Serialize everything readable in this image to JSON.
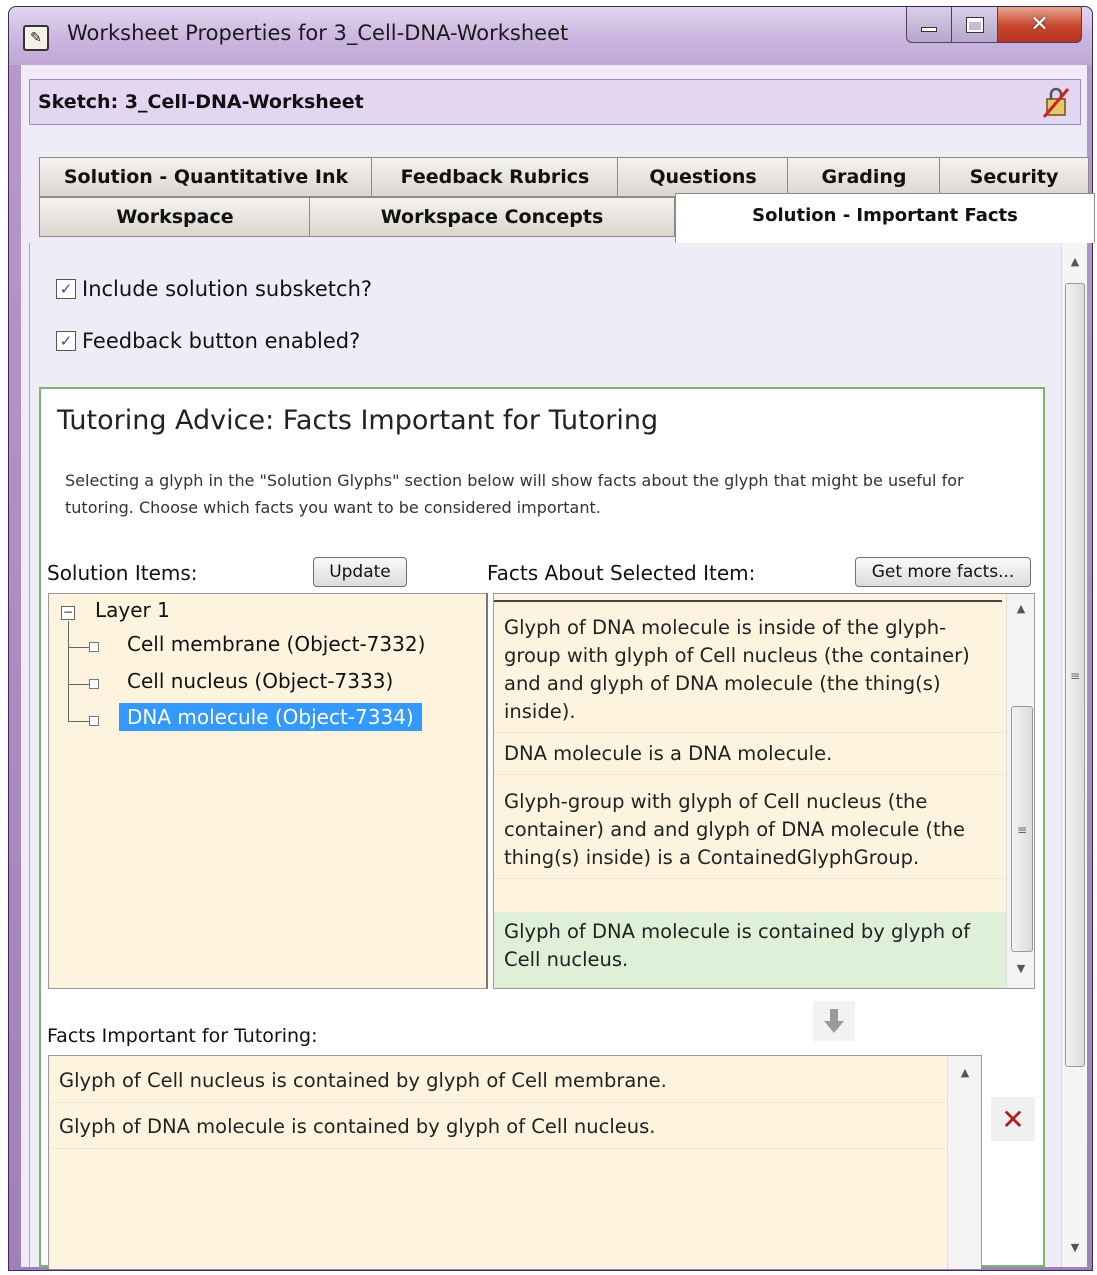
{
  "window": {
    "title": "Worksheet Properties for 3_Cell-DNA-Worksheet",
    "icon": "app-icon"
  },
  "sketch": {
    "label": "Sketch: 3_Cell-DNA-Worksheet",
    "lock_icon": "lock-icon"
  },
  "tabs": {
    "row1": [
      "Solution - Quantitative Ink",
      "Feedback Rubrics",
      "Questions",
      "Grading",
      "Security"
    ],
    "row2": [
      "Workspace",
      "Workspace Concepts",
      "Solution - Important Facts"
    ],
    "active": "Solution - Important Facts"
  },
  "options": {
    "include_solution": {
      "label": "Include solution subsketch?",
      "checked": true
    },
    "feedback_enabled": {
      "label": "Feedback button enabled?",
      "checked": true
    }
  },
  "advice": {
    "title": "Tutoring Advice:  Facts Important for Tutoring",
    "description": "Selecting a glyph in the \"Solution Glyphs\" section below will show facts about the glyph that might be useful for tutoring.  Choose which facts you want to be considered important."
  },
  "solution_items": {
    "label": "Solution Items:",
    "update_button": "Update",
    "tree": {
      "root": "Layer 1",
      "children": [
        "Cell membrane (Object-7332)",
        "Cell nucleus (Object-7333)",
        "DNA molecule (Object-7334)"
      ],
      "selected": "DNA molecule (Object-7334)"
    }
  },
  "facts_selected": {
    "label": "Facts About Selected Item:",
    "more_button": "Get more facts...",
    "items": [
      "Glyph of DNA molecule is inside of the glyph-group with glyph of Cell nucleus (the container) and and glyph of DNA molecule (the thing(s) inside).",
      "DNA molecule is a DNA molecule.",
      "Glyph-group with glyph of Cell nucleus (the container) and and glyph of DNA molecule (the thing(s) inside) is a ContainedGlyphGroup.",
      "Glyph of DNA molecule is contained by glyph of Cell nucleus."
    ]
  },
  "important": {
    "label": "Facts Important for Tutoring:",
    "items": [
      "Glyph of Cell nucleus is contained by glyph of Cell membrane.",
      "Glyph of DNA molecule is contained by glyph of Cell nucleus."
    ]
  }
}
